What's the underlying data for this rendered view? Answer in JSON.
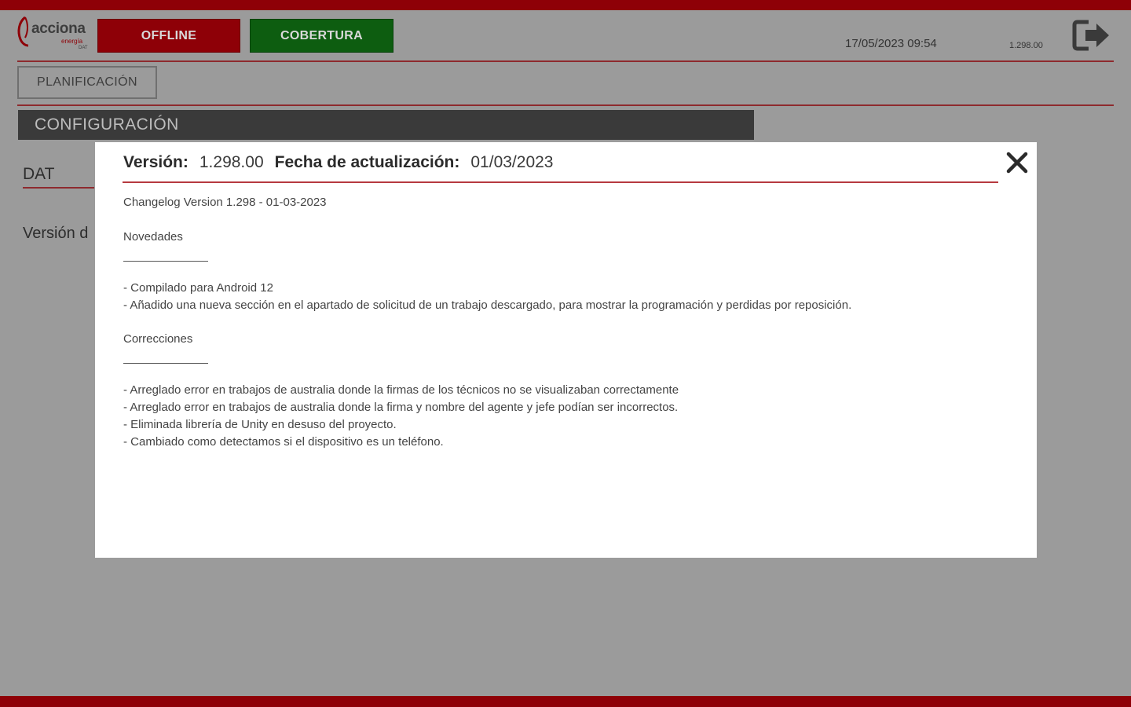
{
  "logo": {
    "brand": "acciona",
    "sub": "energía",
    "sub2": "DAT"
  },
  "header": {
    "offline_label": "OFFLINE",
    "cobertura_label": "COBERTURA",
    "datetime": "17/05/2023 09:54",
    "version": "1.298.00"
  },
  "nav": {
    "planificacion_label": "PLANIFICACIÓN"
  },
  "section": {
    "title": "CONFIGURACIÓN",
    "dat_label": "DAT",
    "version_label": "Versión d"
  },
  "modal": {
    "version_label": "Versión:",
    "version_value": "1.298.00",
    "date_label": "Fecha de actualización:",
    "date_value": "01/03/2023",
    "changelog_title": "Changelog Version 1.298 - 01-03-2023",
    "novedades_heading": "Novedades",
    "novedades_items": [
      "- Compilado para Android 12",
      "- Añadido una nueva sección en el apartado de solicitud de un trabajo descargado, para mostrar la programación y perdidas por reposición."
    ],
    "correcciones_heading": "Correcciones",
    "correcciones_items": [
      "- Arreglado error en trabajos de australia donde la firmas de los técnicos no se visualizaban correctamente",
      "- Arreglado error en trabajos de australia donde la firma y nombre del agente y jefe podían ser incorrectos.",
      "- Eliminada librería de Unity en desuso del proyecto.",
      "- Cambiado como detectamos si el dispositivo es un teléfono."
    ]
  },
  "colors": {
    "brand_red": "#8e0007",
    "cobertura_green": "#0d5d10",
    "overlay_gray": "#9b9b9b",
    "section_dark": "#3a3a3a"
  },
  "icons": {
    "logout": "logout-icon",
    "close": "close-icon",
    "logo": "acciona-logo-icon"
  }
}
